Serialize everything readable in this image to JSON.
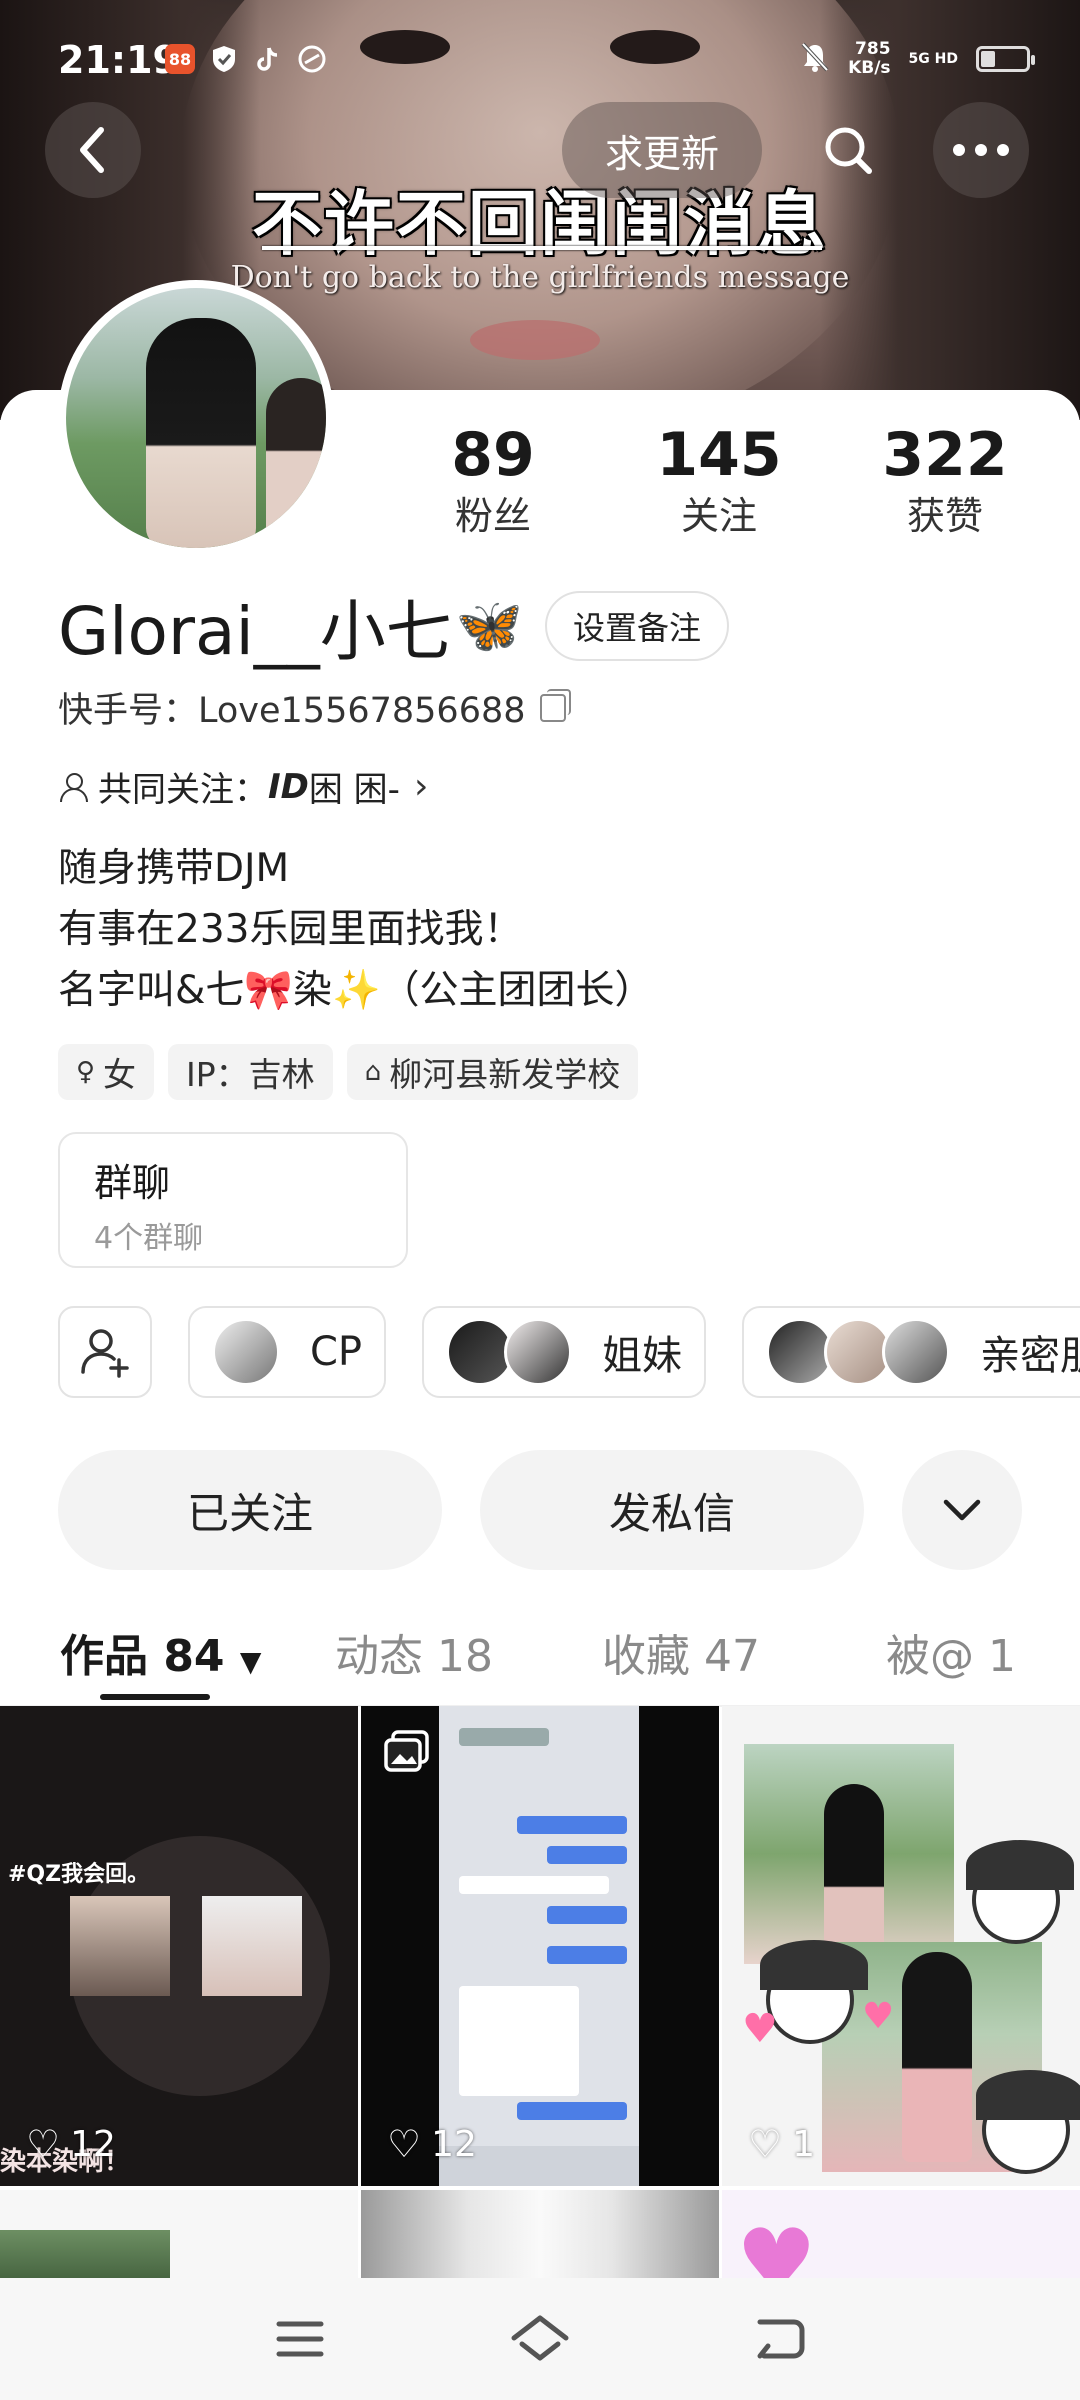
{
  "status_bar": {
    "time": "21:19",
    "speed_value": "785",
    "speed_unit": "KB/s",
    "network": "5G HD"
  },
  "banner": {
    "title": "不许不回闺闺消息",
    "subtitle": "Don't go back to the girlfriends message"
  },
  "top_actions": {
    "update_label": "求更新"
  },
  "stats": [
    {
      "num": "89",
      "label": "粉丝"
    },
    {
      "num": "145",
      "label": "关注"
    },
    {
      "num": "322",
      "label": "获赞"
    }
  ],
  "profile": {
    "name": "Glorai__小七",
    "name_emoji": "🦋",
    "remark_label": "设置备注",
    "kuaishou_id": "快手号：Love15567856688",
    "mutual_prefix": "共同关注：",
    "mutual_id": "ID",
    "mutual_name": "困 困-",
    "bio": [
      "随身携带DJM",
      "有事在233乐园里面找我！",
      "名字叫&七🎀染✨（公主团团长）"
    ]
  },
  "tags": [
    {
      "icon": "♀",
      "label": "女"
    },
    {
      "icon": "",
      "label": "IP：吉林"
    },
    {
      "icon": "⌂",
      "label": "柳河县新发学校"
    }
  ],
  "group_card": {
    "title": "群聊",
    "subtitle": "4个群聊"
  },
  "circles": [
    {
      "label": "CP"
    },
    {
      "label": "姐妹"
    },
    {
      "label": "亲密朋友"
    }
  ],
  "actions": {
    "follow": "已关注",
    "message": "发私信"
  },
  "tabs": [
    {
      "label": "作品 84",
      "active": true
    },
    {
      "label": "动态 18",
      "active": false
    },
    {
      "label": "收藏 47",
      "active": false
    },
    {
      "label": "被@ 1",
      "active": false
    }
  ],
  "works": [
    {
      "likes": "12",
      "caption": "#QZ我会回。",
      "bottom_text": "染本染啊！"
    },
    {
      "likes": "12"
    },
    {
      "likes": "1"
    }
  ]
}
